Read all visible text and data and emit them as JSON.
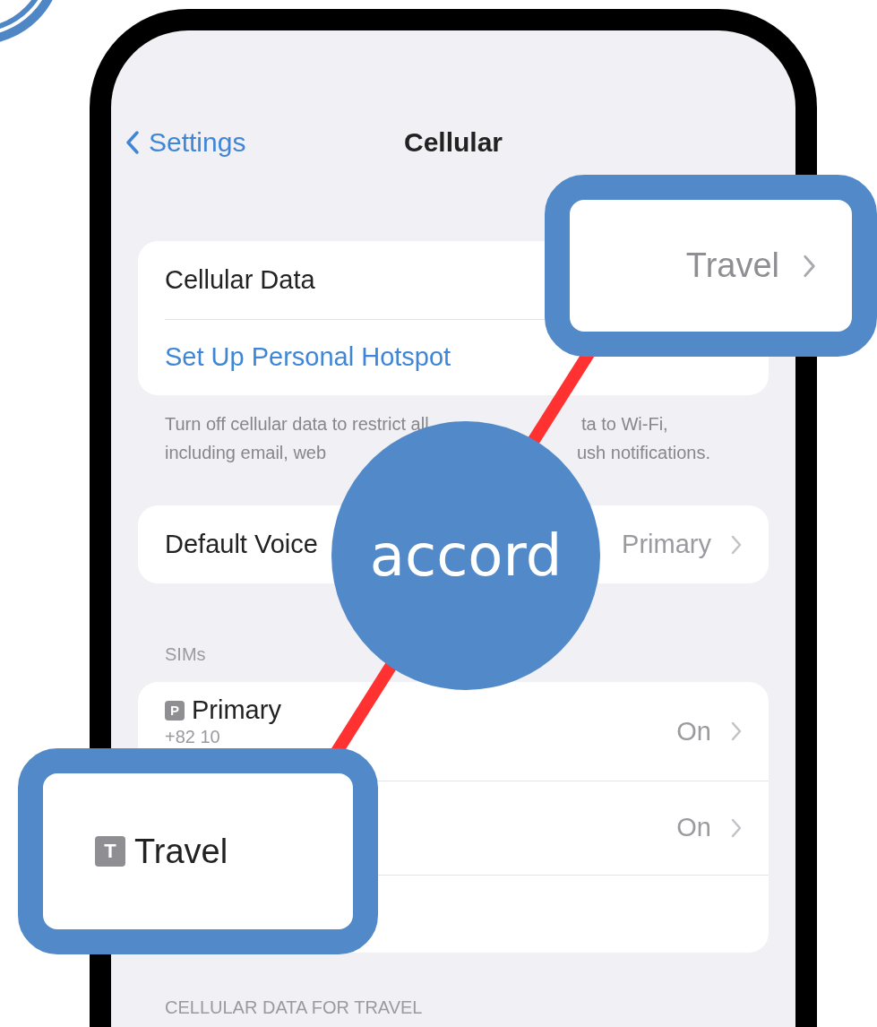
{
  "nav": {
    "back": "Settings",
    "title": "Cellular"
  },
  "cellular_group": {
    "rows": [
      {
        "kind": "value",
        "label": "Cellular Data"
      },
      {
        "kind": "link",
        "label": "Set Up Personal Hotspot"
      }
    ],
    "footer_lines": [
      [
        "Turn off cellular data to restrict all",
        "ta to Wi-Fi,"
      ],
      [
        "including email, web",
        "ush notifications."
      ]
    ]
  },
  "voice_group": {
    "label": "Default Voice",
    "value": "Primary"
  },
  "sims": {
    "header": "SIMs",
    "items": [
      {
        "badge": "P",
        "name": "Primary",
        "number": "+82 10",
        "status": "On"
      },
      {
        "status": "On"
      }
    ]
  },
  "section_header": "CELLULAR DATA FOR TRAVEL",
  "callouts": [
    {
      "kind": "value",
      "text": "Travel"
    },
    {
      "kind": "sim",
      "badge": "T",
      "text": "Travel"
    }
  ],
  "badge": "accord"
}
